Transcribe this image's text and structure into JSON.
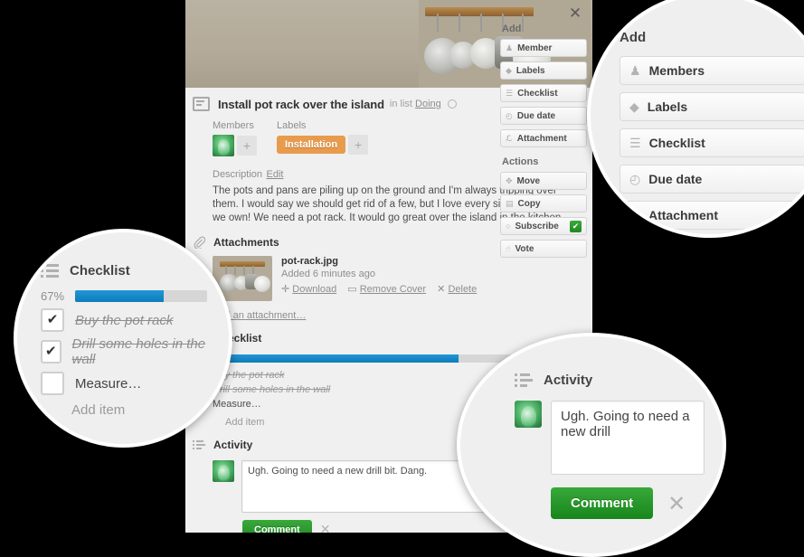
{
  "card": {
    "close_label": "✕",
    "title": "Install pot rack over the island",
    "in_list_prefix": "in list",
    "list_name": "Doing",
    "members_label": "Members",
    "labels_label": "Labels",
    "label_chip": "Installation",
    "label_chip_color": "#e89b4c",
    "add_plus": "+",
    "description_label": "Description",
    "description_edit": "Edit",
    "description_text": "The pots and pans are piling up on the ground and I'm always tripping over them. I would say we should get rid of a few, but I love every single pot and pan we own! We need a pot rack. It would go great over the island in the kitchen.",
    "attachments_title": "Attachments",
    "attachment": {
      "filename": "pot-rack.jpg",
      "added": "Added 6 minutes ago",
      "download": "Download",
      "remove_cover": "Remove Cover",
      "delete": "Delete"
    },
    "add_attachment": "Add an attachment…",
    "checklist_title": "Checklist",
    "checklist_percent": "67%",
    "checklist_percent_value": 67,
    "checklist_items": [
      {
        "text": "Buy the pot rack",
        "checked": true
      },
      {
        "text": "Drill some holes in the wall",
        "checked": true
      },
      {
        "text": "Measure…",
        "checked": false
      }
    ],
    "add_item": "Add item",
    "activity_title": "Activity",
    "comment_value": "Ugh. Going to need a new drill bit. Dang.",
    "comment_button": "Comment",
    "comment_cancel": "✕"
  },
  "sidebar": {
    "add_heading": "Add",
    "add_items": [
      {
        "label": "Member",
        "icon": "person-icon"
      },
      {
        "label": "Labels",
        "icon": "tag-icon"
      },
      {
        "label": "Checklist",
        "icon": "checklist-icon"
      },
      {
        "label": "Due date",
        "icon": "clock-icon"
      },
      {
        "label": "Attachment",
        "icon": "paperclip-icon"
      }
    ],
    "actions_heading": "Actions",
    "action_items": [
      {
        "label": "Move",
        "icon": "arrows-icon"
      },
      {
        "label": "Copy",
        "icon": "copy-icon"
      },
      {
        "label": "Subscribe",
        "icon": "circle-icon",
        "checked": true,
        "check_glyph": "✔"
      },
      {
        "label": "Vote",
        "icon": "thumbs-up-icon"
      }
    ]
  },
  "magnifiers": {
    "add": {
      "heading": "Add",
      "items": [
        {
          "label": "Members",
          "icon": "person-icon"
        },
        {
          "label": "Labels",
          "icon": "tag-icon"
        },
        {
          "label": "Checklist",
          "icon": "checklist-icon"
        },
        {
          "label": "Due date",
          "icon": "clock-icon"
        },
        {
          "label": "Attachment",
          "icon": "paperclip-icon"
        }
      ]
    },
    "checklist": {
      "heading": "Checklist",
      "percent": "67%",
      "percent_value": 67,
      "items": [
        {
          "text": "Buy the pot rack",
          "checked": true,
          "glyph": "✔"
        },
        {
          "text": "Drill some holes in the wall",
          "checked": true,
          "glyph": "✔"
        },
        {
          "text": "Measure…",
          "checked": false,
          "glyph": ""
        }
      ],
      "add_item": "Add item"
    },
    "activity": {
      "heading": "Activity",
      "comment_value": "Ugh. Going to need a new drill ",
      "comment_button": "Comment",
      "cancel": "✕"
    }
  },
  "colors": {
    "accent_blue": "#0d7cba",
    "green": "#1d8a22",
    "label_orange": "#e89b4c",
    "background": "#000000"
  }
}
